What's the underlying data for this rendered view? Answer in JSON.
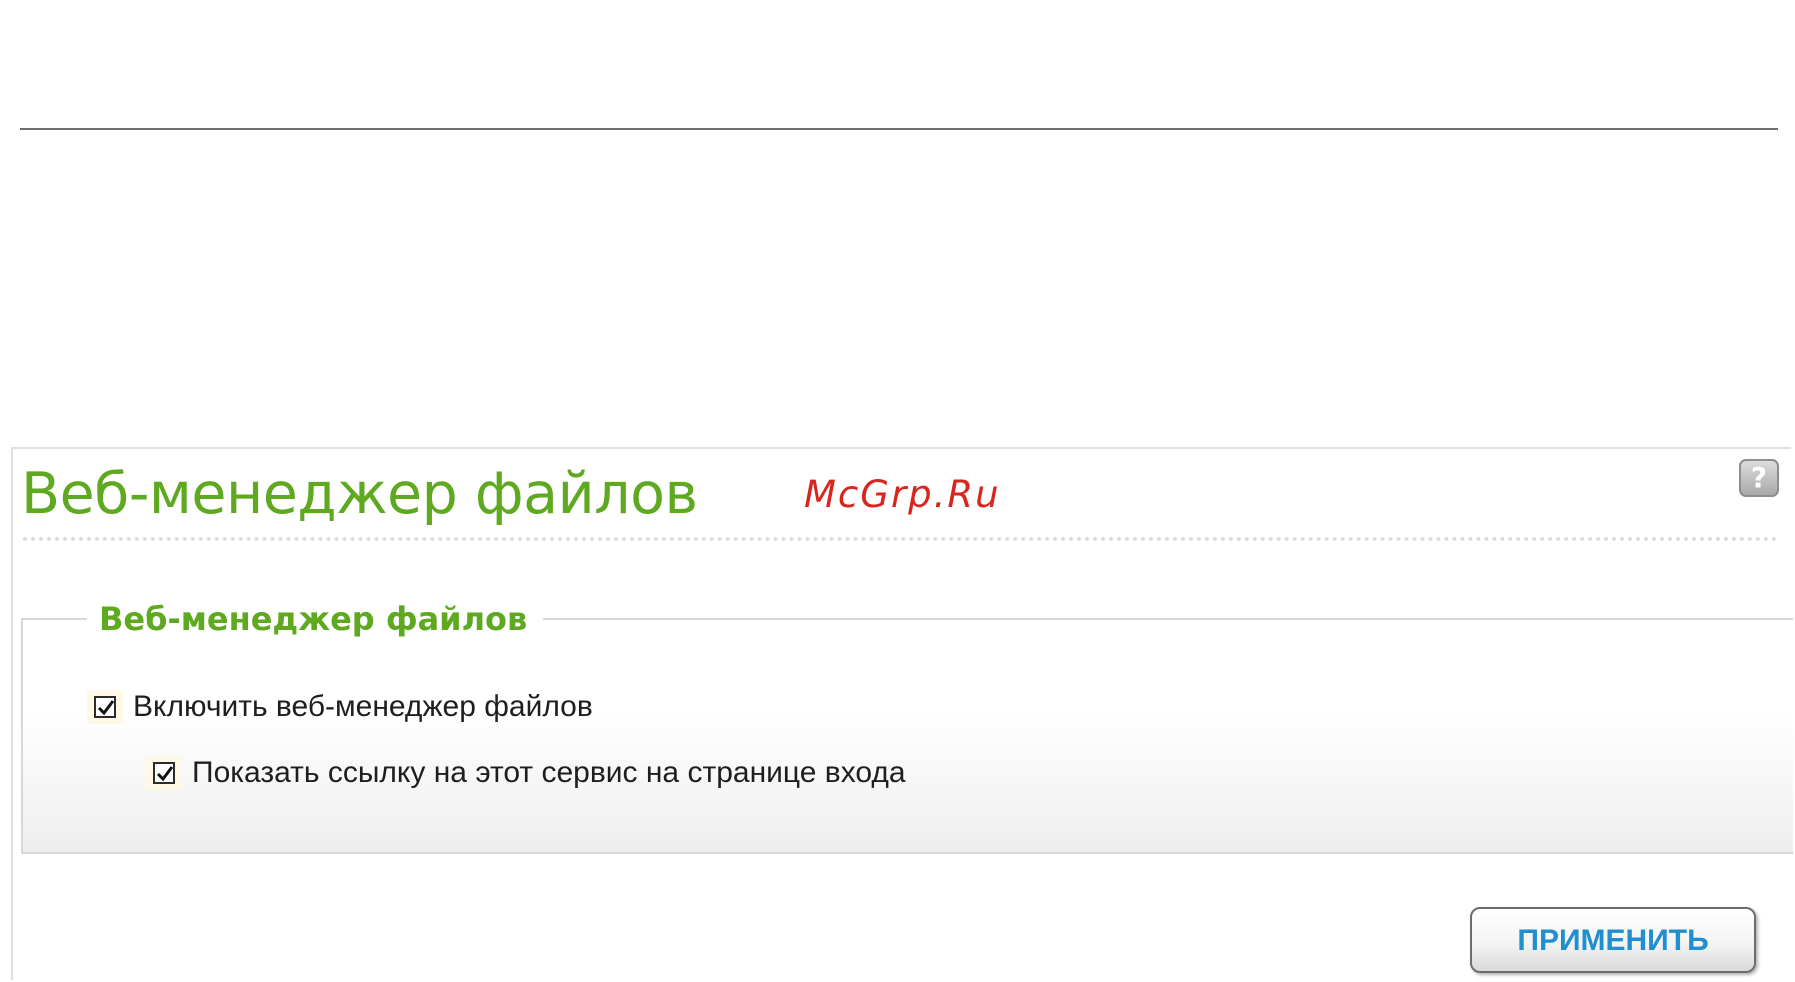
{
  "page": {
    "title": "Веб-менеджер файлов",
    "watermark": "McGrp.Ru",
    "help_icon_glyph": "?"
  },
  "section": {
    "legend": "Веб-менеджер файлов",
    "options": [
      {
        "label": "Включить веб-менеджер файлов",
        "checked": true
      },
      {
        "label": "Показать ссылку на этот сервис на странице входа",
        "checked": true
      }
    ]
  },
  "actions": {
    "apply_label": "ПРИМЕНИТЬ"
  },
  "colors": {
    "title_green": "#5ea91f",
    "watermark_red": "#d7261e",
    "button_text_blue": "#1f8fd0"
  }
}
